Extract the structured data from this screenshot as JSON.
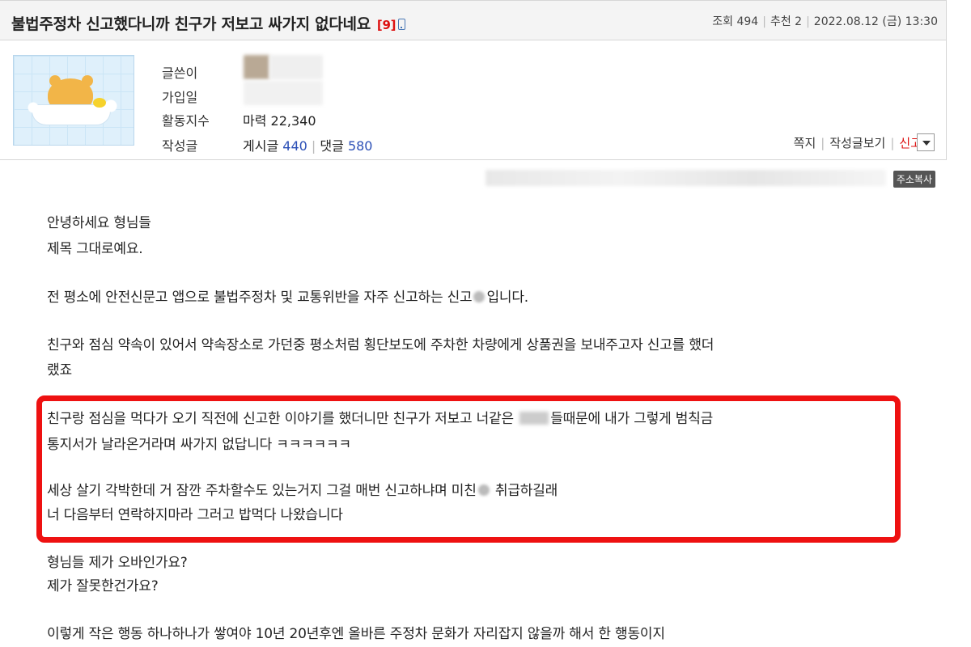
{
  "post": {
    "title": "불법주정차 신고했다니까 친구가 저보고 싸가지 없다네요",
    "comment_count": "[9]",
    "views_label": "조회 494",
    "recommend_label": "추천 2",
    "datetime": "2022.08.12 (금) 13:30"
  },
  "author": {
    "writer_label": "글쓴이",
    "joined_label": "가입일",
    "activity_label": "활동지수",
    "activity_value": "마력 22,340",
    "posts_label": "작성글",
    "posts_prefix": "게시글",
    "posts_count": "440",
    "comments_prefix": "댓글",
    "comments_count": "580"
  },
  "actions": {
    "message": "쪽지",
    "view_posts": "작성글보기",
    "report": "신고"
  },
  "copy_url_label": "주소복사",
  "body": {
    "l1": "안녕하세요 형님들",
    "l2": "제목 그대로예요.",
    "l3a": "전 평소에 안전신문고 앱으로 불법주정차 및 교통위반을 자주 신고하는 신고",
    "l3b": "입니다.",
    "l4": "친구와 점심 약속이 있어서 약속장소로 가던중 평소처럼 횡단보도에 주차한 차량에게 상품권을 보내주고자 신고를 했더",
    "l5": "랬죠",
    "l6a": "친구랑 점심을 먹다가 오기 직전에 신고한 이야기를 했더니만 친구가 저보고 너같은",
    "l6b": "들때문에 내가 그렇게 범칙금",
    "l7": "통지서가 날라온거라며 싸가지 없답니다 ㅋㅋㅋㅋㅋㅋ",
    "l8a": "세상 살기 각박한데 거 잠깐 주차할수도 있는거지 그걸 매번 신고하냐며 미친",
    "l8b": " 취급하길래",
    "l9": "너 다음부터 연락하지마라 그러고 밥먹다 나왔습니다",
    "l10": "형님들 제가 오바인가요?",
    "l11": "제가 잘못한건가요?",
    "l12": "이렇게 작은 행동 하나하나가 쌓여야 10년 20년후엔 올바른 주정차 문화가 자리잡지 않을까 해서 한 행동이지"
  },
  "colors": {
    "highlight": "#ee1111",
    "link_blue": "#2b4fb6",
    "report_red": "#dd1111"
  }
}
